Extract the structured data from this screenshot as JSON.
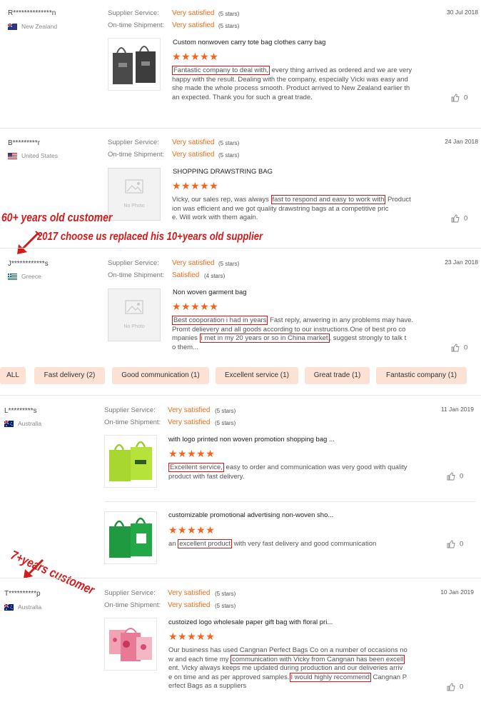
{
  "reviews": [
    {
      "name": "R**************n",
      "country": "New Zealand",
      "flag": "nz-flag-icon",
      "supplier_service_label": "Supplier Service:",
      "supplier_service_value": "Very satisfied",
      "supplier_service_stars": "(5 stars)",
      "shipment_label": "On-time Shipment:",
      "shipment_value": "Very satisfied",
      "shipment_stars": "(5 stars)",
      "date": "30 Jul 2018",
      "product_title": "Custom nonwoven carry tote bag clothes carry bag",
      "rating": 5,
      "review_hl": "Fantastic company to deal with,",
      "review_l1_rest": " every thing arrived as ordered and we are very",
      "review_l2": "happy with the result. Dealing with the company, especially Vicki was easy and",
      "review_l3": "she made the whole process smooth. Product arrived to New Zealand earlier th",
      "review_l4": "an expected. Thank you for such a great trade.",
      "likes": "0"
    },
    {
      "name": "B*********r",
      "country": "United States",
      "flag": "us-flag-icon",
      "supplier_service_label": "Supplier Service:",
      "supplier_service_value": "Very satisfied",
      "supplier_service_stars": "(5 stars)",
      "shipment_label": "On-time Shipment:",
      "shipment_value": "Very satisfied",
      "shipment_stars": "(5 stars)",
      "date": "24 Jan 2018",
      "product_title": "SHOPPING DRAWSTRING BAG",
      "no_photo": "No Photo",
      "rating": 5,
      "review_l1_a": "Vicky, our sales rep, was always ",
      "review_hl": "fast to respond and easy to work with",
      "review_l1_b": " Product",
      "review_l2": "ion was efficient and we got quality drawstring bags at a competitive pric",
      "review_l3": "e. Will work with them again.",
      "likes": "0"
    },
    {
      "name": "J************s",
      "country": "Greece",
      "flag": "gr-flag-icon",
      "supplier_service_label": "Supplier Service:",
      "supplier_service_value": "Very satisfied",
      "supplier_service_stars": "(5 stars)",
      "shipment_label": "On-time Shipment:",
      "shipment_value": "Satisfied",
      "shipment_stars": "(4 stars)",
      "date": "23 Jan 2018",
      "product_title": "Non woven garment bag",
      "no_photo": "No Photo",
      "rating": 5,
      "review_hl1": "Best cooporation i had in years",
      "review_l1_rest": " Fast reply, anwering in any problems may have.",
      "review_l2": "Promt delievery and all goods according to our instructions.One of best pro co",
      "review_l3_a": "mpanies ",
      "review_hl2": "i met in my 20 years or so in China market",
      "review_l3_b": ", suggest strongly to talk t",
      "review_l4": "o them...",
      "likes": "0"
    }
  ],
  "tags": [
    "ALL",
    "Fast delivery (2)",
    "Good communication (1)",
    "Excellent service (1)",
    "Great trade (1)",
    "Fantastic company (1)"
  ],
  "lower_reviews": [
    {
      "name": "L*********s",
      "country": "Australia",
      "flag": "au-flag-icon",
      "supplier_service_label": "Supplier Service:",
      "supplier_service_value": "Very satisfied",
      "supplier_service_stars": "(5 stars)",
      "shipment_label": "On-time Shipment:",
      "shipment_value": "Very satisfied",
      "shipment_stars": "(5 stars)",
      "date": "11 Jan 2019",
      "products": [
        {
          "title": "with logo printed non woven promotion shopping bag ...",
          "rating": 5,
          "review_hl": "Excellent service,",
          "review_l1_rest": " easy to order and communication was very good with quality",
          "review_l2": "product with fast delivery.",
          "likes": "0"
        },
        {
          "title": "customizable promotional advertising non-woven sho...",
          "rating": 5,
          "review_a": "an ",
          "review_hl": "excellent product",
          "review_b": " with very fast delivery and good communication",
          "likes": "0"
        }
      ]
    },
    {
      "name": "T**********p",
      "country": "Australia",
      "flag": "au-flag-icon",
      "supplier_service_label": "Supplier Service:",
      "supplier_service_value": "Very satisfied",
      "supplier_service_stars": "(5 stars)",
      "shipment_label": "On-time Shipment:",
      "shipment_value": "Very satisfied",
      "shipment_stars": "(5 stars)",
      "date": "10 Jan 2019",
      "product_title": "custoized logo wholesale paper gift bag with floral pri...",
      "rating": 5,
      "review_l1": "Our business has used Cangnan Perfect Bags Co on a number of occasions no",
      "review_l2_a": "w and each time my ",
      "review_hl1": "communication with Vicky from Cangnan has been excell",
      "review_l3": "ent. Vicky always keeps me updated during production and our deliveries arriv",
      "review_l4_a": "e on time and as per approved samples.",
      "review_hl2": "I would highly recommend",
      "review_l4_b": " Cangnan P",
      "review_l5": "erfect Bags as a suppliers",
      "likes": "0"
    }
  ],
  "annotations": {
    "a1": "60+ years old customer",
    "a2": "2017 choose us replaced his 10+years old supplier",
    "a3": "7+years customer"
  },
  "colors": {
    "accent": "#ef6c18",
    "star": "#f7631b",
    "highlight": "#d31a1a",
    "tag_bg": "#fbe2d4"
  }
}
